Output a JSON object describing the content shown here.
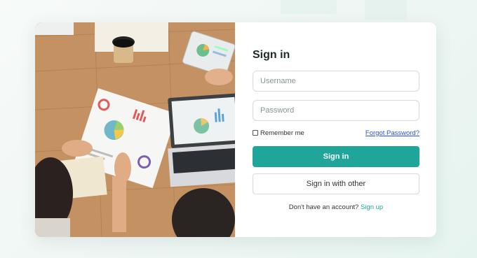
{
  "colors": {
    "accent": "#1fa59a",
    "link": "#2b54c9",
    "background": "#eef6f3",
    "card": "#ffffff"
  },
  "form": {
    "title": "Sign in",
    "username_placeholder": "Username",
    "password_placeholder": "Password",
    "remember_label": "Remember me",
    "forgot_label": "Forgot Password?",
    "signin_label": "Sign in",
    "other_label": "Sign in with other",
    "no_account_text": "Don't have an account?",
    "signup_label": "Sign up"
  },
  "photo": {
    "description_icon": "office-meeting-photo"
  }
}
